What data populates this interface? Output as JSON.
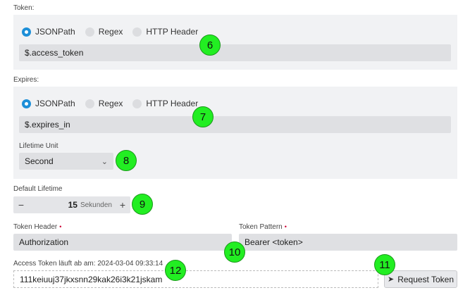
{
  "token": {
    "label": "Token:",
    "options": [
      "JSONPath",
      "Regex",
      "HTTP Header"
    ],
    "selected": "JSONPath",
    "value": "$.access_token"
  },
  "expires": {
    "label": "Expires:",
    "options": [
      "JSONPath",
      "Regex",
      "HTTP Header"
    ],
    "selected": "JSONPath",
    "value": "$.expires_in",
    "lifetime_unit_label": "Lifetime Unit",
    "lifetime_unit_value": "Second"
  },
  "default_lifetime": {
    "label": "Default Lifetime",
    "value": "15",
    "unit": "Sekunden",
    "minus": "−",
    "plus": "+"
  },
  "token_header": {
    "label": "Token Header",
    "required_mark": "•",
    "value": "Authorization"
  },
  "token_pattern": {
    "label": "Token Pattern",
    "required_mark": "•",
    "value": "Bearer <token>"
  },
  "access_token": {
    "label": "Access Token läuft ab am: 2024-03-04 09:33:14",
    "value": "111keiuuj37jkxsnn29kak26i3k21jskam"
  },
  "request_button": {
    "label": "Request Token",
    "icon": "paper-plane-icon"
  },
  "markers": [
    "6",
    "7",
    "8",
    "9",
    "10",
    "11",
    "12"
  ],
  "colors": {
    "accent": "#1d8fd8",
    "marker": "#22ee22",
    "panel": "#f1f2f4",
    "field": "#dfe0e3"
  }
}
